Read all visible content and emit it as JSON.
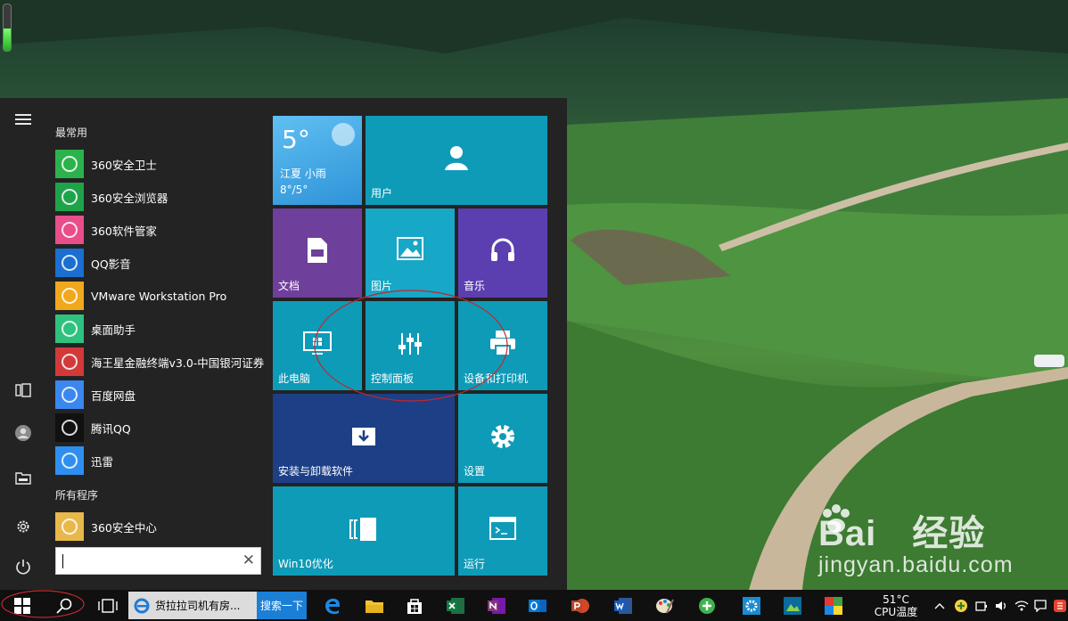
{
  "start_menu": {
    "most_used_heading": "最常用",
    "all_programs_heading": "所有程序",
    "apps": [
      {
        "label": "360安全卫士",
        "color": "#2bb24c"
      },
      {
        "label": "360安全浏览器",
        "color": "#1fa34a"
      },
      {
        "label": "360软件管家",
        "color": "#e84e8a"
      },
      {
        "label": "QQ影音",
        "color": "#1a6fd0"
      },
      {
        "label": "VMware Workstation Pro",
        "color": "#f0a81c"
      },
      {
        "label": "桌面助手",
        "color": "#2ec27e"
      },
      {
        "label": "海王星金融终端v3.0-中国银河证券",
        "color": "#d23a3a"
      },
      {
        "label": "百度网盘",
        "color": "#3b87f0"
      },
      {
        "label": "腾讯QQ",
        "color": "#111111"
      },
      {
        "label": "迅雷",
        "color": "#2f8ff0"
      }
    ],
    "all_programs_apps": [
      {
        "label": "360安全中心",
        "color": "#e8b84a"
      }
    ],
    "search_value": ""
  },
  "tiles": {
    "weather": {
      "temp": "5°",
      "place": "江夏 小雨",
      "range": "8°/5°"
    },
    "user": "用户",
    "documents": "文档",
    "pictures": "图片",
    "music": "音乐",
    "this_pc": "此电脑",
    "control_panel": "控制面板",
    "devices_printers": "设备和打印机",
    "install_uninstall": "安装与卸载软件",
    "settings": "设置",
    "win10_optimize": "Win10优化",
    "run": "运行"
  },
  "taskbar": {
    "ie_tab_text": "货拉拉司机有房...",
    "search_web_btn": "搜索一下",
    "temp": "51°C",
    "cpu_label": "CPU温度"
  },
  "watermark": {
    "brand": "Bai",
    "brand_suffix": "经验",
    "url": "jingyan.baidu.com"
  },
  "colors": {
    "tile_teal": "#0e9bb8",
    "tile_purple": "#6f3f9c",
    "tile_violet": "#5b3fb0",
    "tile_navy": "#1d3f86",
    "tile_weather": "#3aa8e6"
  }
}
